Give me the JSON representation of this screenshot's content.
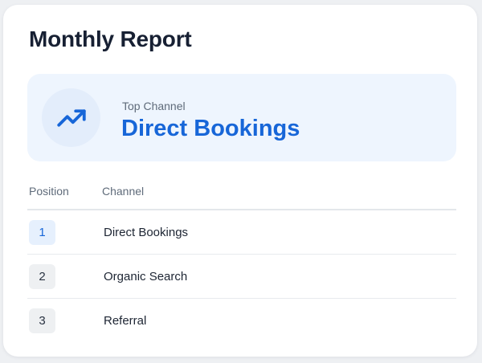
{
  "report": {
    "title": "Monthly Report"
  },
  "highlight": {
    "label": "Top Channel",
    "value": "Direct Bookings",
    "icon": "trending-up-icon"
  },
  "table": {
    "columns": [
      "Position",
      "Channel"
    ],
    "rows": [
      {
        "position": "1",
        "channel": "Direct Bookings"
      },
      {
        "position": "2",
        "channel": "Organic Search"
      },
      {
        "position": "3",
        "channel": "Referral"
      }
    ]
  },
  "colors": {
    "accent": "#1766d8",
    "highlight_bg": "#eef5fe",
    "title": "#172033"
  }
}
